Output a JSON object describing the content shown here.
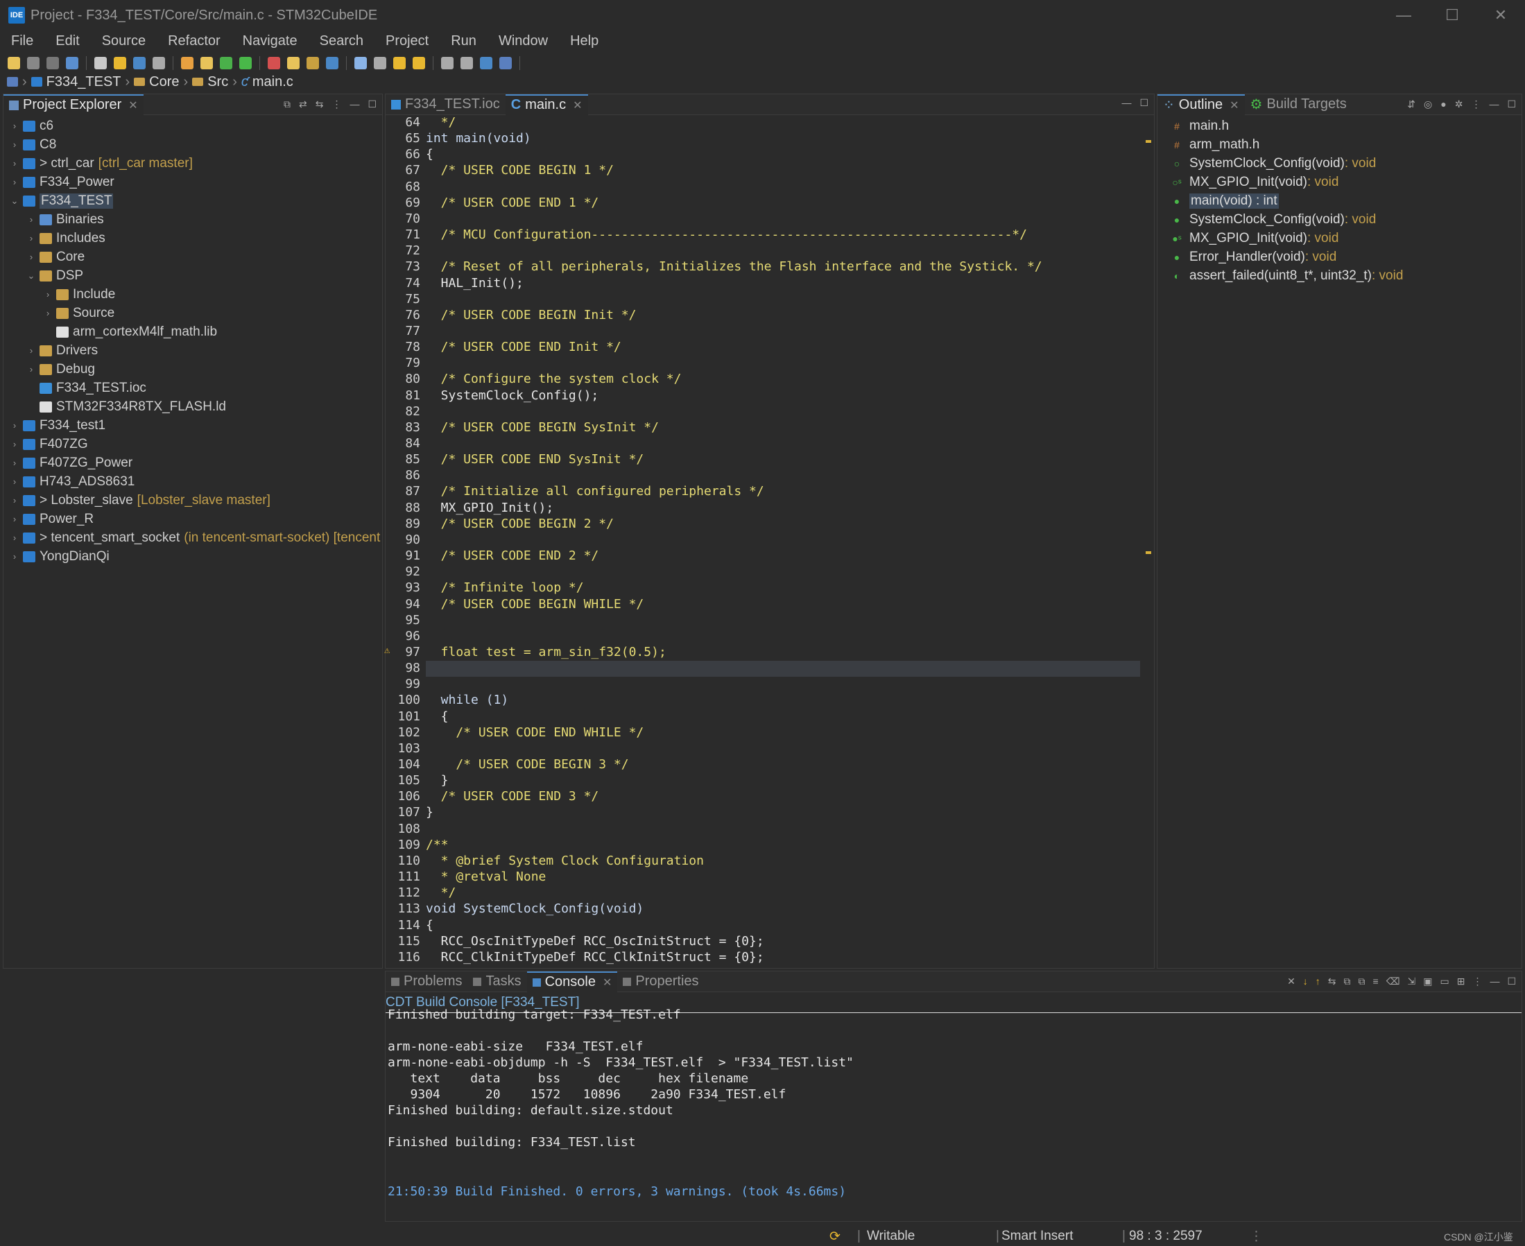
{
  "window": {
    "title": "Project - F334_TEST/Core/Src/main.c - STM32CubeIDE",
    "app_icon": "IDE"
  },
  "menu": [
    "File",
    "Edit",
    "Source",
    "Refactor",
    "Navigate",
    "Search",
    "Project",
    "Run",
    "Window",
    "Help"
  ],
  "breadcrumb": [
    "F334_TEST",
    "Core",
    "Src",
    "main.c"
  ],
  "project_explorer": {
    "title": "Project Explorer",
    "items": [
      {
        "label": "c6",
        "deco": "",
        "icon": "project",
        "indent": 0,
        "arrow": "›"
      },
      {
        "label": "C8",
        "deco": "",
        "icon": "project",
        "indent": 0,
        "arrow": "›"
      },
      {
        "label": "> ctrl_car",
        "deco": "[ctrl_car master]",
        "icon": "project",
        "indent": 0,
        "arrow": "›"
      },
      {
        "label": "F334_Power",
        "deco": "",
        "icon": "project",
        "indent": 0,
        "arrow": "›"
      },
      {
        "label": "F334_TEST",
        "deco": "",
        "icon": "project",
        "indent": 0,
        "arrow": "⌄",
        "selected": true
      },
      {
        "label": "Binaries",
        "deco": "",
        "icon": "binaries",
        "indent": 1,
        "arrow": "›"
      },
      {
        "label": "Includes",
        "deco": "",
        "icon": "folder",
        "indent": 1,
        "arrow": "›"
      },
      {
        "label": "Core",
        "deco": "",
        "icon": "folder",
        "indent": 1,
        "arrow": "›"
      },
      {
        "label": "DSP",
        "deco": "",
        "icon": "folder",
        "indent": 1,
        "arrow": "⌄"
      },
      {
        "label": "Include",
        "deco": "",
        "icon": "folder",
        "indent": 2,
        "arrow": "›"
      },
      {
        "label": "Source",
        "deco": "",
        "icon": "folder",
        "indent": 2,
        "arrow": "›"
      },
      {
        "label": "arm_cortexM4lf_math.lib",
        "deco": "",
        "icon": "file",
        "indent": 2,
        "arrow": ""
      },
      {
        "label": "Drivers",
        "deco": "",
        "icon": "folder",
        "indent": 1,
        "arrow": "›"
      },
      {
        "label": "Debug",
        "deco": "",
        "icon": "folder",
        "indent": 1,
        "arrow": "›"
      },
      {
        "label": "F334_TEST.ioc",
        "deco": "",
        "icon": "mx",
        "indent": 1,
        "arrow": ""
      },
      {
        "label": "STM32F334R8TX_FLASH.ld",
        "deco": "",
        "icon": "file",
        "indent": 1,
        "arrow": ""
      },
      {
        "label": "F334_test1",
        "deco": "",
        "icon": "project",
        "indent": 0,
        "arrow": "›"
      },
      {
        "label": "F407ZG",
        "deco": "",
        "icon": "project",
        "indent": 0,
        "arrow": "›"
      },
      {
        "label": "F407ZG_Power",
        "deco": "",
        "icon": "project",
        "indent": 0,
        "arrow": "›"
      },
      {
        "label": "H743_ADS8631",
        "deco": "",
        "icon": "project",
        "indent": 0,
        "arrow": "›"
      },
      {
        "label": "> Lobster_slave",
        "deco": "[Lobster_slave master]",
        "icon": "project",
        "indent": 0,
        "arrow": "›"
      },
      {
        "label": "Power_R",
        "deco": "",
        "icon": "project",
        "indent": 0,
        "arrow": "›"
      },
      {
        "label": "> tencent_smart_socket",
        "deco": "(in tencent-smart-socket) [tencent",
        "icon": "project",
        "indent": 0,
        "arrow": "›"
      },
      {
        "label": "YongDianQi",
        "deco": "",
        "icon": "project",
        "indent": 0,
        "arrow": "›"
      }
    ]
  },
  "editor": {
    "tabs": [
      {
        "label": "F334_TEST.ioc",
        "active": false
      },
      {
        "label": "main.c",
        "active": true
      }
    ],
    "lines": [
      {
        "n": "64",
        "t": "  */",
        "c": "cm"
      },
      {
        "n": "65",
        "t": "int main(void)",
        "c": "kw"
      },
      {
        "n": "66",
        "t": "{",
        "c": ""
      },
      {
        "n": "67",
        "t": "  /* USER CODE BEGIN 1 */",
        "c": "cm"
      },
      {
        "n": "68",
        "t": "",
        "c": ""
      },
      {
        "n": "69",
        "t": "  /* USER CODE END 1 */",
        "c": "cm"
      },
      {
        "n": "70",
        "t": "",
        "c": ""
      },
      {
        "n": "71",
        "t": "  /* MCU Configuration--------------------------------------------------------*/",
        "c": "cm"
      },
      {
        "n": "72",
        "t": "",
        "c": ""
      },
      {
        "n": "73",
        "t": "  /* Reset of all peripherals, Initializes the Flash interface and the Systick. */",
        "c": "cm"
      },
      {
        "n": "74",
        "t": "  HAL_Init();",
        "c": ""
      },
      {
        "n": "75",
        "t": "",
        "c": ""
      },
      {
        "n": "76",
        "t": "  /* USER CODE BEGIN Init */",
        "c": "cm"
      },
      {
        "n": "77",
        "t": "",
        "c": ""
      },
      {
        "n": "78",
        "t": "  /* USER CODE END Init */",
        "c": "cm"
      },
      {
        "n": "79",
        "t": "",
        "c": ""
      },
      {
        "n": "80",
        "t": "  /* Configure the system clock */",
        "c": "cm"
      },
      {
        "n": "81",
        "t": "  SystemClock_Config();",
        "c": ""
      },
      {
        "n": "82",
        "t": "",
        "c": ""
      },
      {
        "n": "83",
        "t": "  /* USER CODE BEGIN SysInit */",
        "c": "cm"
      },
      {
        "n": "84",
        "t": "",
        "c": ""
      },
      {
        "n": "85",
        "t": "  /* USER CODE END SysInit */",
        "c": "cm"
      },
      {
        "n": "86",
        "t": "",
        "c": ""
      },
      {
        "n": "87",
        "t": "  /* Initialize all configured peripherals */",
        "c": "cm"
      },
      {
        "n": "88",
        "t": "  MX_GPIO_Init();",
        "c": ""
      },
      {
        "n": "89",
        "t": "  /* USER CODE BEGIN 2 */",
        "c": "cm"
      },
      {
        "n": "90",
        "t": "",
        "c": ""
      },
      {
        "n": "91",
        "t": "  /* USER CODE END 2 */",
        "c": "cm"
      },
      {
        "n": "92",
        "t": "",
        "c": ""
      },
      {
        "n": "93",
        "t": "  /* Infinite loop */",
        "c": "cm"
      },
      {
        "n": "94",
        "t": "  /* USER CODE BEGIN WHILE */",
        "c": "cm"
      },
      {
        "n": "95",
        "t": "",
        "c": ""
      },
      {
        "n": "96",
        "t": "",
        "c": ""
      },
      {
        "n": "97",
        "t": "  float test = arm_sin_f32(0.5);",
        "c": "cm"
      },
      {
        "n": "98",
        "t": "",
        "c": ""
      },
      {
        "n": "99",
        "t": "",
        "c": ""
      },
      {
        "n": "100",
        "t": "  while (1)",
        "c": "kw"
      },
      {
        "n": "101",
        "t": "  {",
        "c": ""
      },
      {
        "n": "102",
        "t": "    /* USER CODE END WHILE */",
        "c": "cm"
      },
      {
        "n": "103",
        "t": "",
        "c": ""
      },
      {
        "n": "104",
        "t": "    /* USER CODE BEGIN 3 */",
        "c": "cm"
      },
      {
        "n": "105",
        "t": "  }",
        "c": ""
      },
      {
        "n": "106",
        "t": "  /* USER CODE END 3 */",
        "c": "cm"
      },
      {
        "n": "107",
        "t": "}",
        "c": ""
      },
      {
        "n": "108",
        "t": "",
        "c": ""
      },
      {
        "n": "109",
        "t": "/**",
        "c": "cm"
      },
      {
        "n": "110",
        "t": "  * @brief System Clock Configuration",
        "c": "cm"
      },
      {
        "n": "111",
        "t": "  * @retval None",
        "c": "cm"
      },
      {
        "n": "112",
        "t": "  */",
        "c": "cm"
      },
      {
        "n": "113",
        "t": "void SystemClock_Config(void)",
        "c": "kw"
      },
      {
        "n": "114",
        "t": "{",
        "c": ""
      },
      {
        "n": "115",
        "t": "  RCC_OscInitTypeDef RCC_OscInitStruct = {0};",
        "c": "ty"
      },
      {
        "n": "116",
        "t": "  RCC_ClkInitTypeDef RCC_ClkInitStruct = {0};",
        "c": "ty"
      }
    ]
  },
  "outline": {
    "tabs": [
      {
        "label": "Outline",
        "active": true
      },
      {
        "label": "Build Targets",
        "active": false
      }
    ],
    "items": [
      {
        "label": "main.h",
        "ret": "",
        "icon": "#",
        "color": "#c37b3c"
      },
      {
        "label": "arm_math.h",
        "ret": "",
        "icon": "#",
        "color": "#c37b3c"
      },
      {
        "label": "SystemClock_Config(void)",
        "ret": " : void",
        "icon": "○",
        "color": "#49b849"
      },
      {
        "label": "MX_GPIO_Init(void)",
        "ret": " : void",
        "icon": "○ˢ",
        "color": "#49b849"
      },
      {
        "label": "main(void) : int",
        "ret": "",
        "icon": "●",
        "color": "#49b849",
        "selected": true
      },
      {
        "label": "SystemClock_Config(void)",
        "ret": " : void",
        "icon": "●",
        "color": "#49b849"
      },
      {
        "label": "MX_GPIO_Init(void)",
        "ret": " : void",
        "icon": "●ˢ",
        "color": "#49b849"
      },
      {
        "label": "Error_Handler(void)",
        "ret": " : void",
        "icon": "●",
        "color": "#49b849"
      },
      {
        "label": "assert_failed(uint8_t*, uint32_t)",
        "ret": " : void",
        "icon": "◐",
        "color": "#49b849"
      }
    ]
  },
  "console": {
    "tabs": [
      {
        "label": "Problems",
        "active": false
      },
      {
        "label": "Tasks",
        "active": false
      },
      {
        "label": "Console",
        "active": true
      },
      {
        "label": "Properties",
        "active": false
      }
    ],
    "header": "CDT Build Console [F334_TEST]",
    "lines": [
      "Finished building target: F334_TEST.elf",
      "",
      "arm-none-eabi-size   F334_TEST.elf",
      "arm-none-eabi-objdump -h -S  F334_TEST.elf  > \"F334_TEST.list\"",
      "   text    data     bss     dec     hex filename",
      "   9304      20    1572   10896    2a90 F334_TEST.elf",
      "Finished building: default.size.stdout",
      "",
      "Finished building: F334_TEST.list",
      "",
      ""
    ],
    "finish_line": "21:50:39 Build Finished. 0 errors, 3 warnings. (took 4s.66ms)"
  },
  "status": {
    "writable": "Writable",
    "insert": "Smart Insert",
    "position": "98 : 3 : 2597",
    "watermark": "CSDN @江小鉴"
  }
}
